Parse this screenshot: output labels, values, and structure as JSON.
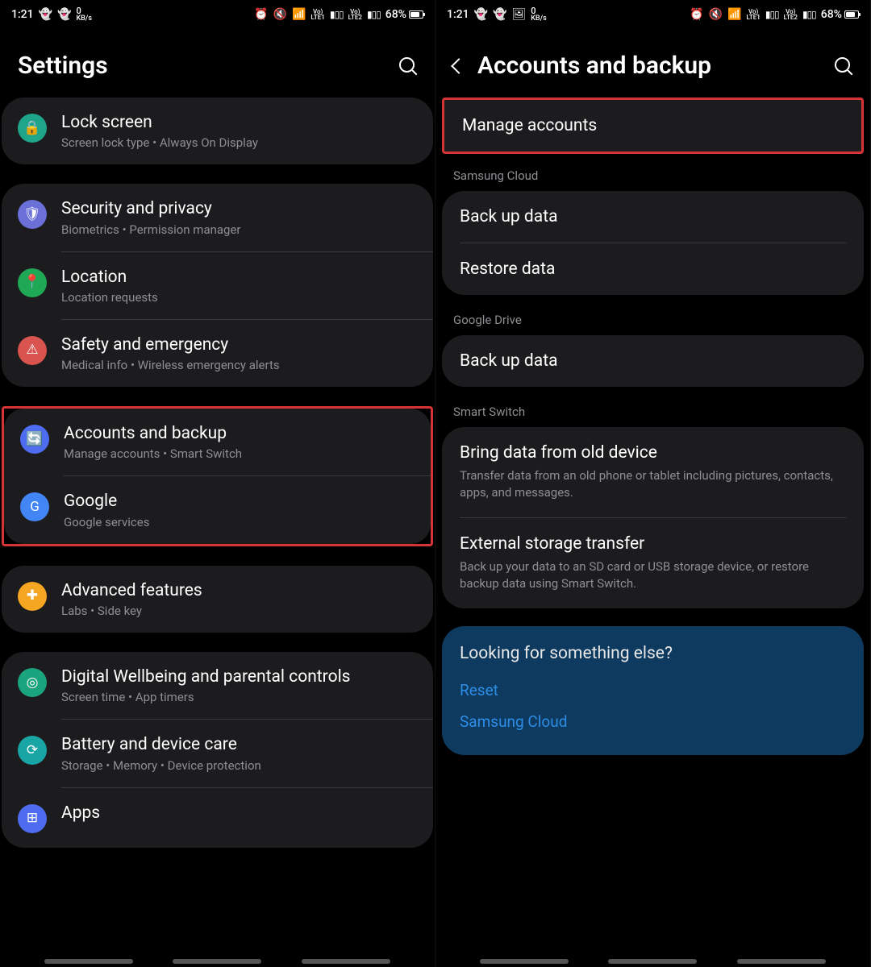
{
  "status": {
    "time": "1:21",
    "kbps_value": "0",
    "kbps_unit": "KB/s",
    "battery": "68%"
  },
  "left": {
    "title": "Settings",
    "groups": [
      {
        "items": [
          {
            "name": "lock-screen",
            "icon": "lock",
            "iconbg": "bg-teal",
            "title": "Lock screen",
            "sub": "Screen lock type  •  Always On Display"
          }
        ]
      },
      {
        "items": [
          {
            "name": "security-privacy",
            "icon": "shield",
            "iconbg": "bg-purple",
            "title": "Security and privacy",
            "sub": "Biometrics  •  Permission manager"
          },
          {
            "name": "location",
            "icon": "pin",
            "iconbg": "bg-green",
            "title": "Location",
            "sub": "Location requests"
          },
          {
            "name": "safety-emergency",
            "icon": "alert",
            "iconbg": "bg-red",
            "title": "Safety and emergency",
            "sub": "Medical info  •  Wireless emergency alerts"
          }
        ]
      },
      {
        "highlightIndex": 0,
        "items": [
          {
            "name": "accounts-backup",
            "icon": "sync",
            "iconbg": "bg-blue",
            "title": "Accounts and backup",
            "sub": "Manage accounts  •  Smart Switch"
          },
          {
            "name": "google",
            "icon": "G",
            "iconbg": "bg-gblue",
            "title": "Google",
            "sub": "Google services"
          }
        ]
      },
      {
        "items": [
          {
            "name": "advanced-features",
            "icon": "plus",
            "iconbg": "bg-orange",
            "title": "Advanced features",
            "sub": "Labs  •  Side key"
          }
        ]
      },
      {
        "items": [
          {
            "name": "digital-wellbeing",
            "icon": "heart",
            "iconbg": "bg-teal2",
            "title": "Digital Wellbeing and parental controls",
            "sub": "Screen time  •  App timers"
          },
          {
            "name": "battery-care",
            "icon": "care",
            "iconbg": "bg-teal3",
            "title": "Battery and device care",
            "sub": "Storage  •  Memory  •  Device protection"
          },
          {
            "name": "apps",
            "icon": "grid",
            "iconbg": "bg-blue2",
            "title": "Apps",
            "sub": ""
          }
        ]
      }
    ]
  },
  "right": {
    "title": "Accounts and backup",
    "rows": [
      {
        "type": "group",
        "highlight": true,
        "items": [
          {
            "name": "manage-accounts",
            "title": "Manage accounts"
          }
        ]
      },
      {
        "type": "label",
        "text": "Samsung Cloud"
      },
      {
        "type": "group",
        "items": [
          {
            "name": "backup-data-samsung",
            "title": "Back up data"
          },
          {
            "name": "restore-data",
            "title": "Restore data"
          }
        ]
      },
      {
        "type": "label",
        "text": "Google Drive"
      },
      {
        "type": "group",
        "items": [
          {
            "name": "backup-data-google",
            "title": "Back up data"
          }
        ]
      },
      {
        "type": "label",
        "text": "Smart Switch"
      },
      {
        "type": "group",
        "items": [
          {
            "name": "bring-data",
            "title": "Bring data from old device",
            "sub": "Transfer data from an old phone or tablet including pictures, contacts, apps, and messages."
          },
          {
            "name": "external-storage",
            "title": "External storage transfer",
            "sub": "Back up your data to an SD card or USB storage device, or restore backup data using Smart Switch."
          }
        ]
      }
    ],
    "suggest": {
      "q": "Looking for something else?",
      "links": [
        "Reset",
        "Samsung Cloud"
      ]
    }
  }
}
